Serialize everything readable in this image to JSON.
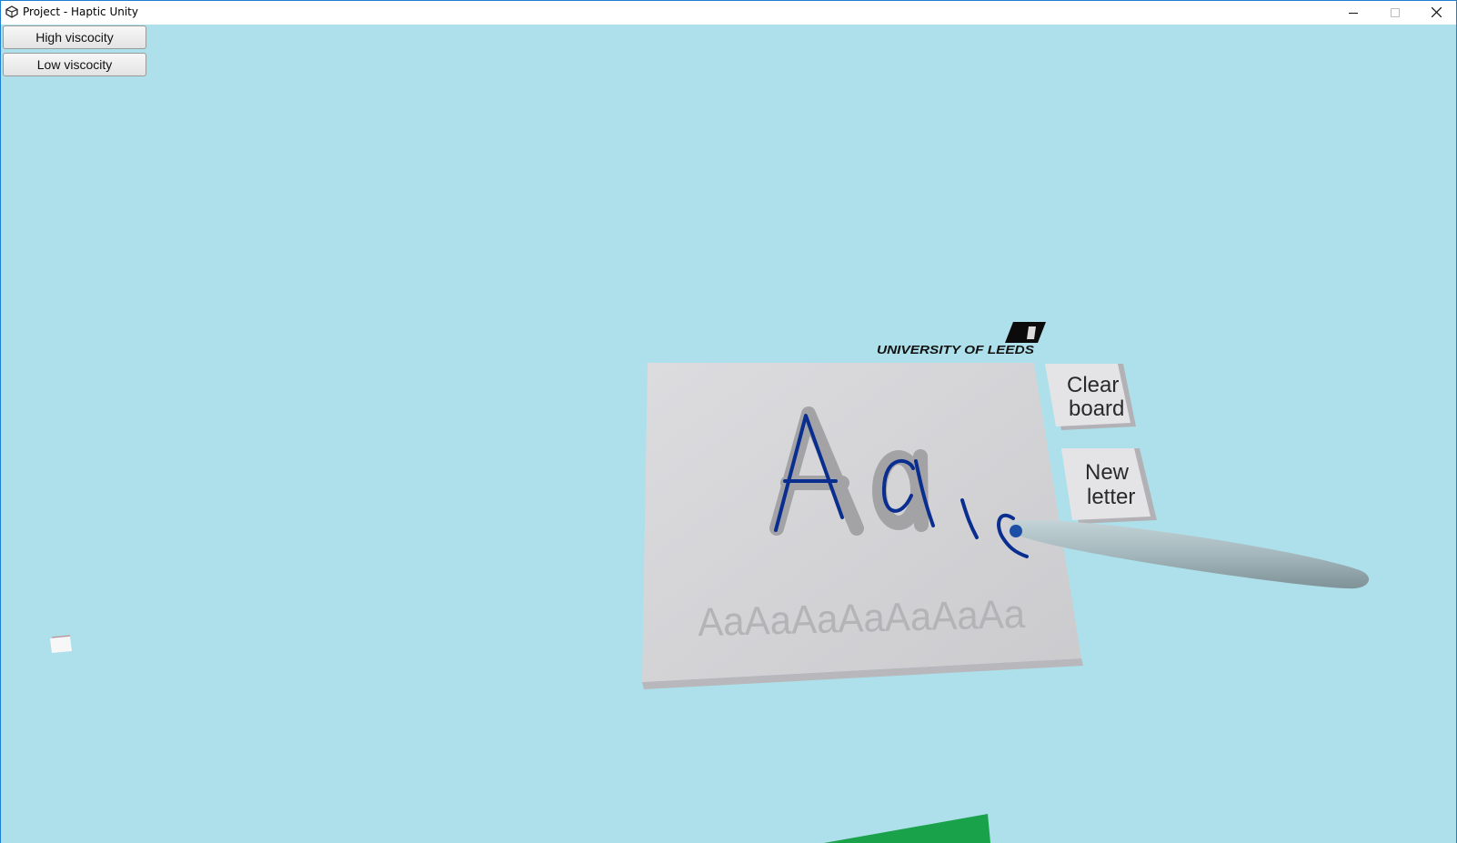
{
  "window": {
    "title": "Project - Haptic Unity",
    "controls": {
      "minimize_icon": "minimize-icon",
      "maximize_icon": "maximize-icon",
      "close_icon": "close-icon"
    }
  },
  "gui": {
    "high_viscosity_label": "High viscocity",
    "low_viscosity_label": "Low viscocity"
  },
  "scene": {
    "logo_text": "UNIVERSITY OF LEEDS",
    "board": {
      "template_text": "Aa",
      "practice_row": "AaAaAaAaAaAaAa"
    },
    "buttons": {
      "clear_board": [
        "Clear",
        "board"
      ],
      "new_letter": [
        "New",
        "letter"
      ]
    }
  },
  "colors": {
    "sky": "#ade0ea",
    "board": "#d3d3d6",
    "ink": "#0a2e8f",
    "stylus": "#a6b8bd",
    "ground": "#1aa24a"
  }
}
